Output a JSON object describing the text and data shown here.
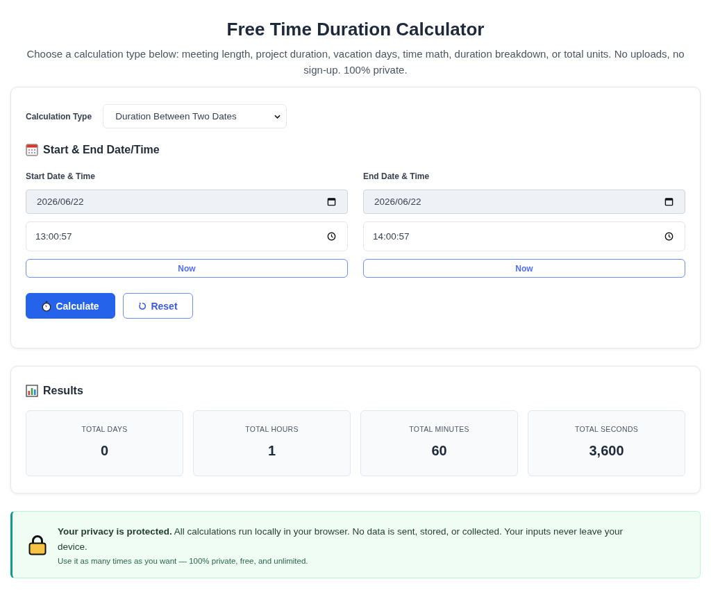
{
  "header": {
    "title": "Free Time Duration Calculator",
    "subtitle": "Choose a calculation type below: meeting length, project duration, vacation days, time math, duration breakdown, or total units. No uploads, no sign-up. 100% private."
  },
  "calculator": {
    "type_label": "Calculation Type",
    "type_value": "Duration Between Two Dates",
    "section_title": "Start & End Date/Time",
    "columns": [
      {
        "label": "Start Date & Time",
        "date": "2026/06/22",
        "time": "13:00:57",
        "now_button": "Now"
      },
      {
        "label": "End Date & Time",
        "date": "2026/06/22",
        "time": "14:00:57",
        "now_button": "Now"
      }
    ],
    "actions": [
      {
        "kind": "primary",
        "label": "Calculate"
      },
      {
        "kind": "secondary",
        "label": "Reset"
      }
    ]
  },
  "results": {
    "title": "Results",
    "items": [
      {
        "label": "TOTAL DAYS",
        "value": "0"
      },
      {
        "label": "TOTAL HOURS",
        "value": "1"
      },
      {
        "label": "TOTAL MINUTES",
        "value": "60"
      },
      {
        "label": "TOTAL SECONDS",
        "value": "3,600"
      }
    ]
  },
  "privacy": {
    "text": "**Your privacy is protected.** All calculations run locally in your browser. No data is sent, stored, or collected. Your inputs never leave your device.",
    "note": "Use it as many times as you want — 100% private, free, and unlimited."
  }
}
